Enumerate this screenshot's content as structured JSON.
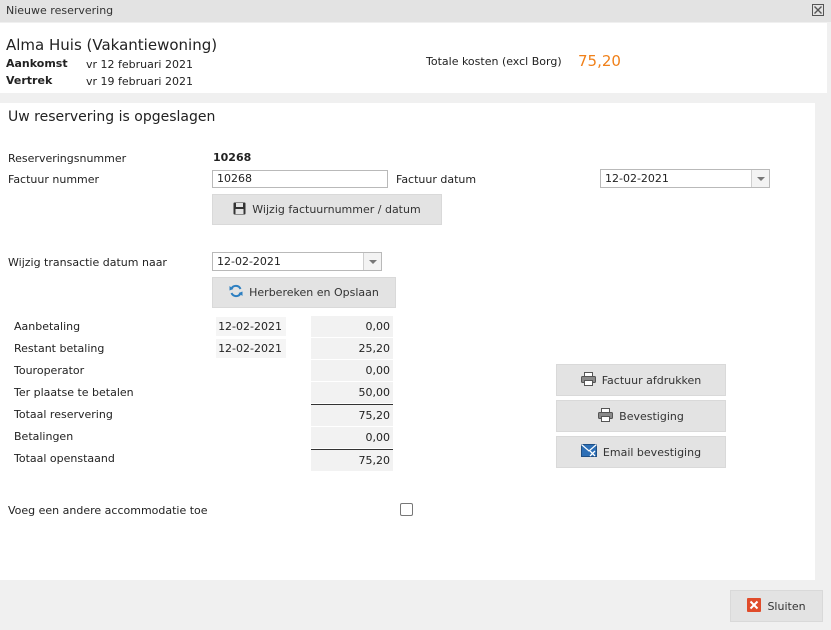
{
  "window": {
    "title": "Nieuwe reservering"
  },
  "header": {
    "accommodation": "Alma Huis (Vakantiewoning)",
    "arrival_label": "Aankomst",
    "arrival_value": "vr 12 februari 2021",
    "departure_label": "Vertrek",
    "departure_value": "vr 19 februari 2021",
    "total_label": "Totale kosten (excl Borg)",
    "total_value": "75,20"
  },
  "main": {
    "saved_message": "Uw reservering is opgeslagen",
    "reservation_number_label": "Reserveringsnummer",
    "reservation_number_value": "10268",
    "invoice_number_label": "Factuur nummer",
    "invoice_number_value": "10268",
    "invoice_date_label": "Factuur datum",
    "invoice_date_value": "12-02-2021",
    "change_invoice_button": "Wijzig factuurnummer / datum",
    "transaction_date_label": "Wijzig transactie datum naar",
    "transaction_date_value": "12-02-2021",
    "recalc_button": "Herbereken en Opslaan",
    "payments": [
      {
        "label": "Aanbetaling",
        "date": "12-02-2021",
        "amount": "0,00"
      },
      {
        "label": "Restant betaling",
        "date": "12-02-2021",
        "amount": "25,20"
      },
      {
        "label": "Touroperator",
        "date": "",
        "amount": "0,00"
      },
      {
        "label": "Ter plaatse te betalen",
        "date": "",
        "amount": "50,00"
      },
      {
        "label": "Totaal reservering",
        "date": "",
        "amount": "75,20"
      },
      {
        "label": "Betalingen",
        "date": "",
        "amount": "0,00"
      },
      {
        "label": "Totaal openstaand",
        "date": "",
        "amount": "75,20"
      }
    ],
    "print_invoice_button": "Factuur afdrukken",
    "confirmation_button": "Bevestiging",
    "email_confirmation_button": "Email bevestiging",
    "add_accommodation_label": "Voeg een andere accommodatie toe"
  },
  "footer": {
    "close_button": "Sluiten"
  },
  "colors": {
    "accent": "#f08019",
    "close_icon": "#e04b2a",
    "email_icon": "#2d6fb6",
    "recalc_icon": "#2d7fc1"
  },
  "icons": [
    "close-icon",
    "save-icon",
    "refresh-icon",
    "printer-icon",
    "email-icon",
    "close-red-icon"
  ]
}
